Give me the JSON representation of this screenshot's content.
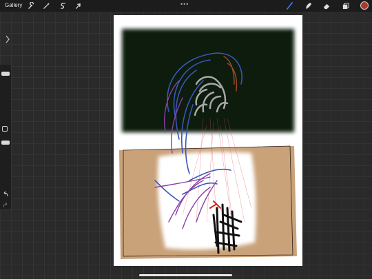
{
  "toolbar": {
    "gallery_label": "Gallery",
    "left_tools": [
      "wrench-icon",
      "magic-wand-icon",
      "selection-icon",
      "transform-arrow-icon"
    ],
    "more_label": "•••",
    "right_tools": [
      "brush-icon",
      "smudge-icon",
      "eraser-icon",
      "layers-icon"
    ],
    "active_tool": "brush-icon",
    "current_color": "#a83a28"
  },
  "sidebar": {
    "items": [
      "brush-size-slider",
      "modify-button",
      "opacity-slider",
      "undo-button",
      "redo-button"
    ]
  },
  "canvas": {
    "colors": {
      "background": "#ffffff",
      "dark_panel": "#111a10",
      "tan_panel": "#c9a27a",
      "white_panel": "#ffffff"
    }
  }
}
